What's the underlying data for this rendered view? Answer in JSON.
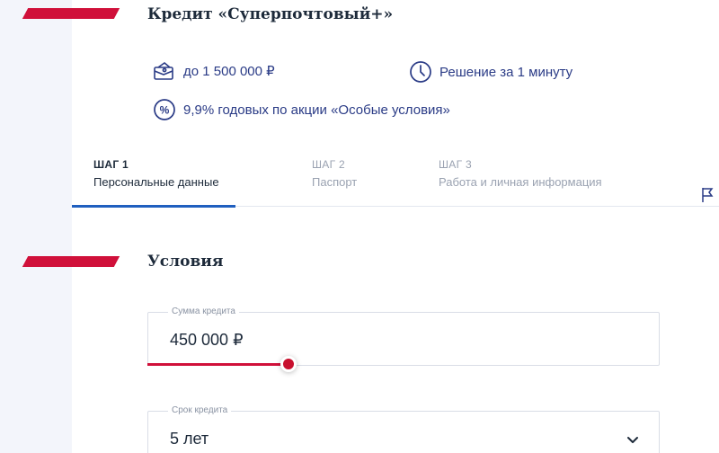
{
  "header": {
    "title": "Кредит «Суперпочтовый+»",
    "amount_feature": "до 1 500 000 ₽",
    "decision_feature": "Решение за 1 минуту",
    "rate_feature": "9,9% годовых по акции «Особые условия»"
  },
  "steps": [
    {
      "num": "ШАГ 1",
      "label": "Персональные данные",
      "state": "active"
    },
    {
      "num": "ШАГ 2",
      "label": "Паспорт",
      "state": "inactive"
    },
    {
      "num": "ШАГ 3",
      "label": "Работа и личная информация",
      "state": "inactive"
    }
  ],
  "conditions": {
    "title": "Условия",
    "loan_amount": {
      "label": "Сумма кредита",
      "value": "450 000 ₽",
      "slider_fraction": 0.275
    },
    "loan_term": {
      "label": "Срок кредита",
      "value": "5 лет"
    }
  },
  "colors": {
    "accent_red": "#d0103a",
    "brand_blue": "#2a3b86",
    "step_active": "#1f5fbf"
  },
  "icons": {
    "amount": "wallet-icon",
    "decision": "clock-icon",
    "rate": "percent-icon",
    "flag": "flag-icon",
    "chevron": "chevron-down-icon"
  }
}
